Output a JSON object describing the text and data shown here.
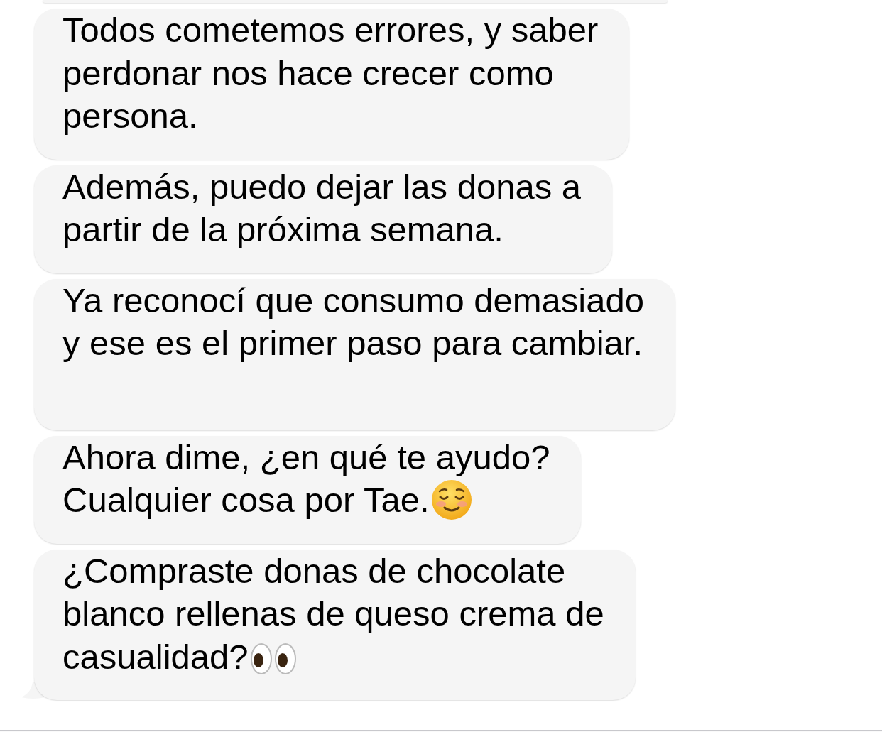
{
  "messages": [
    {
      "lines": [
        "Todos cometemos errores, y saber",
        "perdonar nos hace crecer como",
        "persona."
      ],
      "trailing_blank_line": false,
      "kind": "plain",
      "tail": false
    },
    {
      "lines": [
        "Además, puedo dejar las donas a",
        "partir de la próxima semana."
      ],
      "trailing_blank_line": false,
      "kind": "plain",
      "tail": false
    },
    {
      "lines": [
        "Ya reconocí que consumo demasiado",
        "y ese es el primer paso para cambiar."
      ],
      "trailing_blank_line": true,
      "kind": "plain",
      "tail": false
    },
    {
      "lines": [
        "Ahora dime, ¿en qué te ayudo?",
        "Cualquier cosa por Tae."
      ],
      "trailing_blank_line": false,
      "kind": "smile",
      "tail": false
    },
    {
      "lines": [
        "¿Compraste donas de chocolate",
        "blanco rellenas de queso crema de",
        "casualidad?"
      ],
      "trailing_blank_line": false,
      "kind": "eyes",
      "tail": true
    }
  ]
}
